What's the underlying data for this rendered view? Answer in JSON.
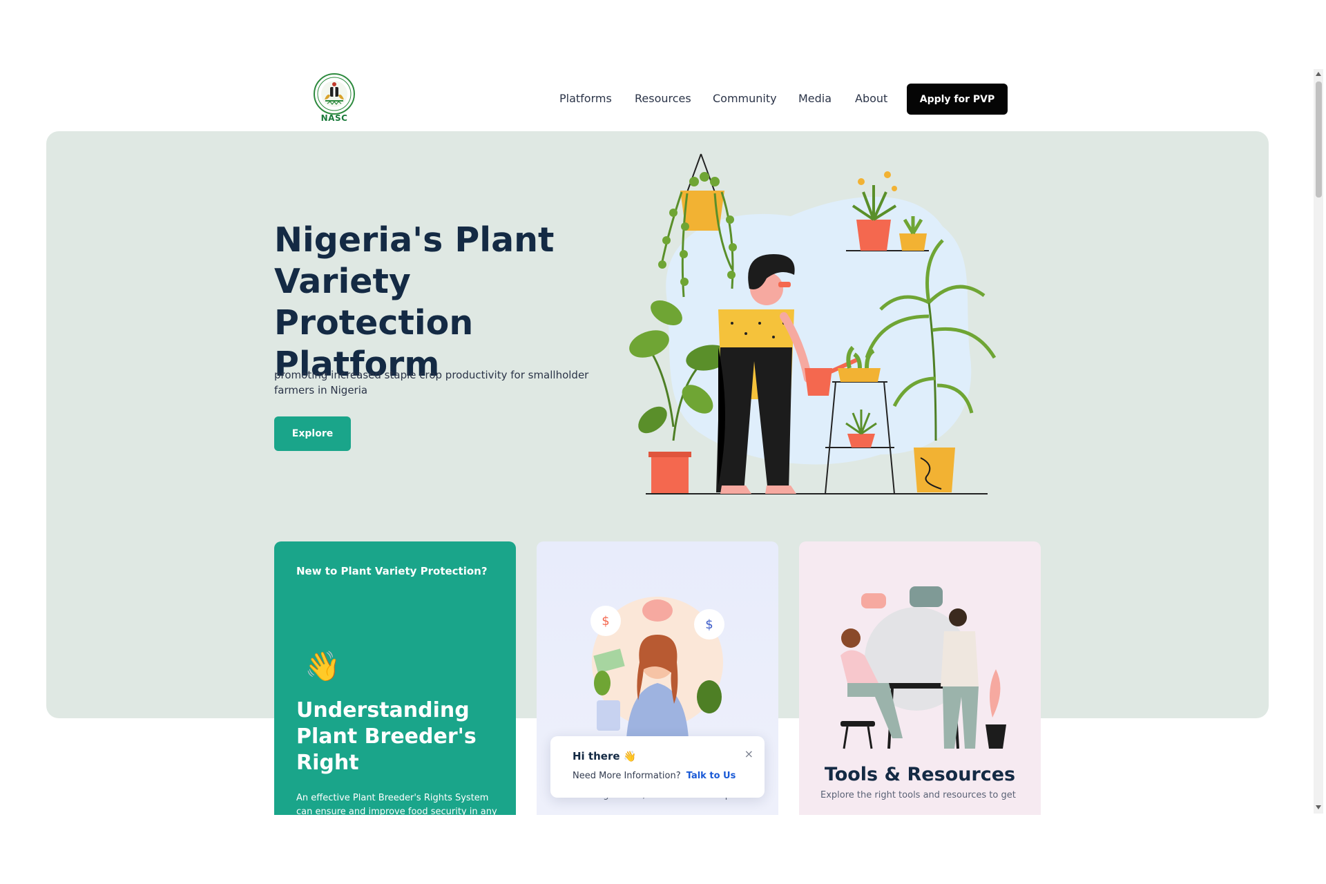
{
  "header": {
    "logo_text": "NASC",
    "nav": [
      "Platforms",
      "Resources",
      "Community",
      "Media",
      "About"
    ],
    "cta_label": "Apply for PVP"
  },
  "hero": {
    "title": "Nigeria's Plant Variety Protection Platform",
    "subtitle": "promoting increased staple crop productivity for smallholder farmers in Nigeria",
    "explore_label": "Explore"
  },
  "cards": {
    "green": {
      "kicker": "New to Plant Variety Protection?",
      "emoji": "👋",
      "heading": "Understanding Plant Breeder's Right",
      "desc": "An effective Plant Breeder's Rights System can ensure and improve food security in any"
    },
    "blue": {
      "desc": "Find the right tools, resources and expertise"
    },
    "pink": {
      "title": "Tools & Resources",
      "desc": "Explore the right tools and resources to get"
    }
  },
  "chat": {
    "greeting": "Hi there 👋",
    "question": "Need More Information?",
    "link": "Talk to Us",
    "close": "×"
  },
  "colors": {
    "accent_green": "#1aa58a",
    "hero_bg": "#dfe8e3",
    "cta_black": "#050505",
    "link_blue": "#1a5ad6",
    "heading_navy": "#142a44"
  }
}
